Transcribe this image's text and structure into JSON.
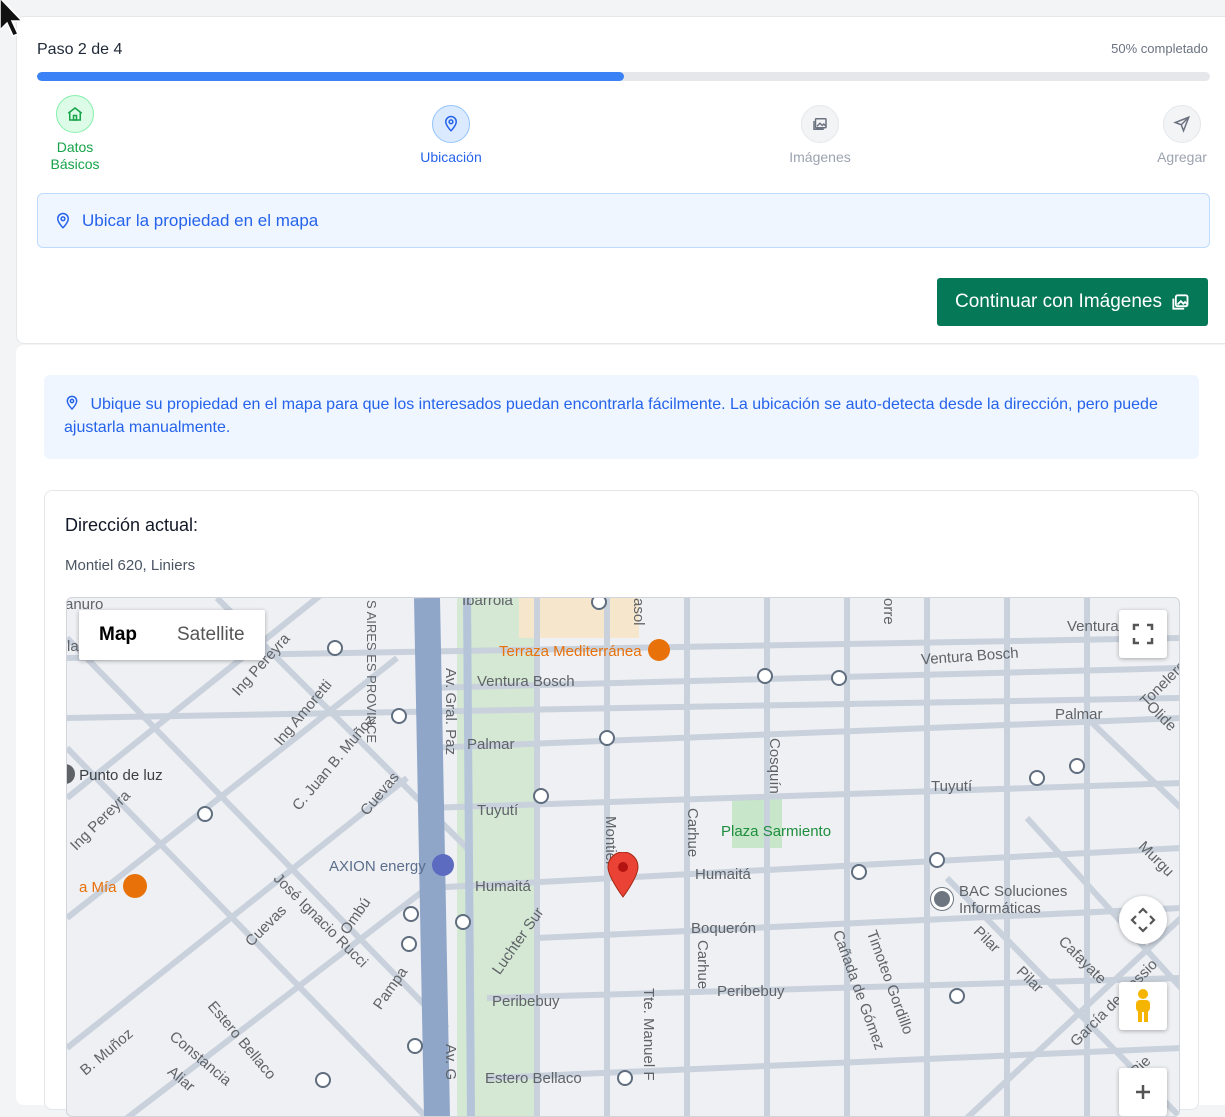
{
  "progress": {
    "step_label": "Paso 2 de 4",
    "percent_label": "50% completado",
    "percent": 50
  },
  "steps": [
    {
      "label": "Datos Básicos",
      "icon": "home-icon",
      "state": "completed"
    },
    {
      "label": "Ubicación",
      "icon": "pin-icon",
      "state": "active"
    },
    {
      "label": "Imágenes",
      "icon": "images-icon",
      "state": "pending"
    },
    {
      "label": "Agregar",
      "icon": "send-icon",
      "state": "pending"
    }
  ],
  "section_banner": {
    "text": "Ubicar la propiedad en el mapa"
  },
  "continue_button": {
    "label": "Continuar con Imágenes"
  },
  "info_banner": {
    "text": "Ubique su propiedad en el mapa para que los interesados puedan encontrarla fácilmente. La ubicación se auto-detecta desde la dirección, pero puede ajustarla manualmente."
  },
  "address": {
    "title": "Dirección actual:",
    "value": "Montiel 620, Liniers"
  },
  "map": {
    "toggle": {
      "map": "Map",
      "satellite": "Satellite"
    },
    "streets": {
      "ventura_bosch_1": "Ventura Bosch",
      "ventura_bosch_2": "Ventura Bosch",
      "ventura": "Ventura",
      "palmar_1": "Palmar",
      "palmar_2": "Palmar",
      "tuyuti_1": "Tuyutí",
      "tuyuti_2": "Tuyutí",
      "humaita_1": "Humaitá",
      "humaita_2": "Humaitá",
      "boqueron": "Boquerón",
      "peribebuy_1": "Peribebuy",
      "peribebuy_2": "Peribebuy",
      "estero_bellaco_1": "Estero Bellaco",
      "estero_bellaco_2": "Estero Bellaco",
      "av_gral_paz": "Av. Gral. Paz",
      "av_g": "Av. G",
      "montiel": "Montiel",
      "carhue_1": "Carhue",
      "carhue_2": "Carhue",
      "cosquin": "Cosquín",
      "ing_pereyra": "Ing Pereyra",
      "ing_amoretti": "Ing Amoretti",
      "c_juan_b_munoz": "C. Juan B. Muñoz",
      "cuevas_1": "Cuevas",
      "cuevas_2": "Cuevas",
      "jose_ignacio_rucci": "José Ignacio Rucci",
      "ombu": "Ombú",
      "pampa": "Pampa",
      "luchter_sur": "Luchter Sur",
      "constancia": "Constancia",
      "b_munoz": "B. Muñoz",
      "aliar": "Aliar",
      "tte_manuel_f": "Tte. Manuel F",
      "canada_de_gomez": "Cañada de Gómez",
      "timoteo_gordillo": "Timoteo Gordillo",
      "pilar_1": "Pilar",
      "pilar_2": "Pilar",
      "cafayate": "Cafayate",
      "garcia_de_cossio": "García de Cossio",
      "murgu": "Murgu",
      "tonelero": "Tonelero",
      "olide": "Olide",
      "aires_province": "S AIRES ES PROVINCE",
      "ibarrola": "Ibarrola",
      "canuro": "anuro",
      "torre": "orre",
      "asol": "asol",
      "la": "la",
      "pje": "Pje"
    },
    "pois": {
      "terraza": "Terraza Mediterránea",
      "axion": "AXION energy",
      "punto_de_luz": "Punto de luz",
      "la_mia": "a Mía",
      "plaza": "Plaza Sarmiento",
      "bac_1": "BAC Soluciones",
      "bac_2": "Informáticas"
    }
  },
  "colors": {
    "primary_blue": "#3b82f6",
    "success_green": "#16a34a",
    "button_green": "#047857",
    "marker_red": "#ea4335"
  }
}
